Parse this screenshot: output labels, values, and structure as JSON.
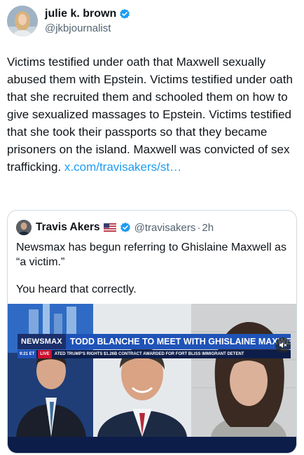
{
  "author": {
    "display_name": "julie k. brown",
    "handle": "@jkbjournalist"
  },
  "tweet": {
    "text": "Victims testified under oath that Maxwell sexually abused them with Epstein. Victims testified under oath that she recruited them and schooled them on how to give sexualized massages to Epstein. Victims testified that she took their passports so that they became prisoners on the island. Maxwell was convicted of sex trafficking. ",
    "link": "x.com/travisakers/st…"
  },
  "quote": {
    "display_name": "Travis Akers",
    "handle": "@travisakers",
    "separator": "·",
    "time": "2h",
    "text_line1": "Newsmax has begun referring to Ghislaine Maxwell as “a victim.”",
    "text_line2": "You heard that correctly."
  },
  "media": {
    "chyron_brand": "NEWSMAX",
    "chyron_headline": "TODD BLANCHE TO MEET WITH GHISLAINE MAXWELL",
    "ticker_time": "9:21 ET",
    "ticker_live": "LIVE",
    "ticker_text": "ATED TRUMP'S RIGHTS     $1.26B CONTRACT AWARDED FOR FORT BLISS IMMIGRANT DETENT"
  },
  "icons": {
    "verified": "verified-badge-icon",
    "flag": "us-flag-icon",
    "mute": "speaker-mute-icon"
  },
  "colors": {
    "link": "#1d9bf0",
    "verified": "#1d9bf0",
    "secondary_text": "#536471",
    "newsmax_blue": "#1f53b8"
  }
}
